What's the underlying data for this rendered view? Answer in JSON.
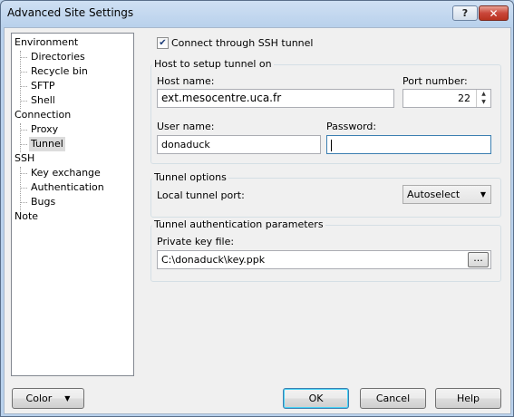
{
  "window": {
    "title": "Advanced Site Settings",
    "help_button": "?",
    "close_button": "✕"
  },
  "tree": {
    "environment": "Environment",
    "directories": "Directories",
    "recycle_bin": "Recycle bin",
    "sftp": "SFTP",
    "shell": "Shell",
    "connection": "Connection",
    "proxy": "Proxy",
    "tunnel": "Tunnel",
    "ssh": "SSH",
    "key_exchange": "Key exchange",
    "authentication": "Authentication",
    "bugs": "Bugs",
    "note": "Note",
    "selected": "Tunnel"
  },
  "tunnel": {
    "connect_checkbox_label": "Connect through SSH tunnel",
    "connect_checked": true,
    "host_group_label": "Host to setup tunnel on",
    "host_name_label": "Host name:",
    "host_name_value": "ext.mesocentre.uca.fr",
    "port_label": "Port number:",
    "port_value": "22",
    "user_name_label": "User name:",
    "user_name_value": "donaduck",
    "password_label": "Password:",
    "password_value": "",
    "options_group_label": "Tunnel options",
    "local_port_label": "Local tunnel port:",
    "local_port_value": "Autoselect",
    "auth_group_label": "Tunnel authentication parameters",
    "private_key_label": "Private key file:",
    "private_key_value": "C:\\donaduck\\key.ppk",
    "browse_button": "..."
  },
  "footer": {
    "color_button": "Color",
    "ok_button": "OK",
    "cancel_button": "Cancel",
    "help_button": "Help"
  }
}
